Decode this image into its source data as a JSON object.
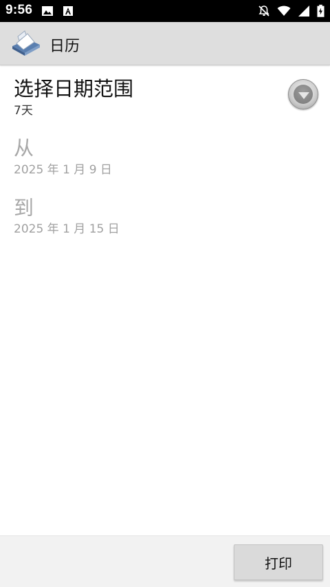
{
  "status_bar": {
    "time": "9:56",
    "left_icons": [
      "image-icon",
      "a-app-icon"
    ],
    "right_icons": [
      "notifications-off-icon",
      "wifi-icon",
      "signal-icon",
      "battery-charging-icon"
    ]
  },
  "app_bar": {
    "title": "日历",
    "logo_icon": "printer-logo-icon"
  },
  "date_range": {
    "title": "选择日期范围",
    "value": "7天"
  },
  "from": {
    "label": "从",
    "date": "2025 年 1 月 9 日"
  },
  "to": {
    "label": "到",
    "date": "2025 年 1 月 15 日"
  },
  "bottom_bar": {
    "print_label": "打印"
  },
  "colors": {
    "status_bar_bg": "#000000",
    "app_bar_bg": "#dedede",
    "disabled_text": "#a8a8a8",
    "button_bg": "#dadada"
  }
}
